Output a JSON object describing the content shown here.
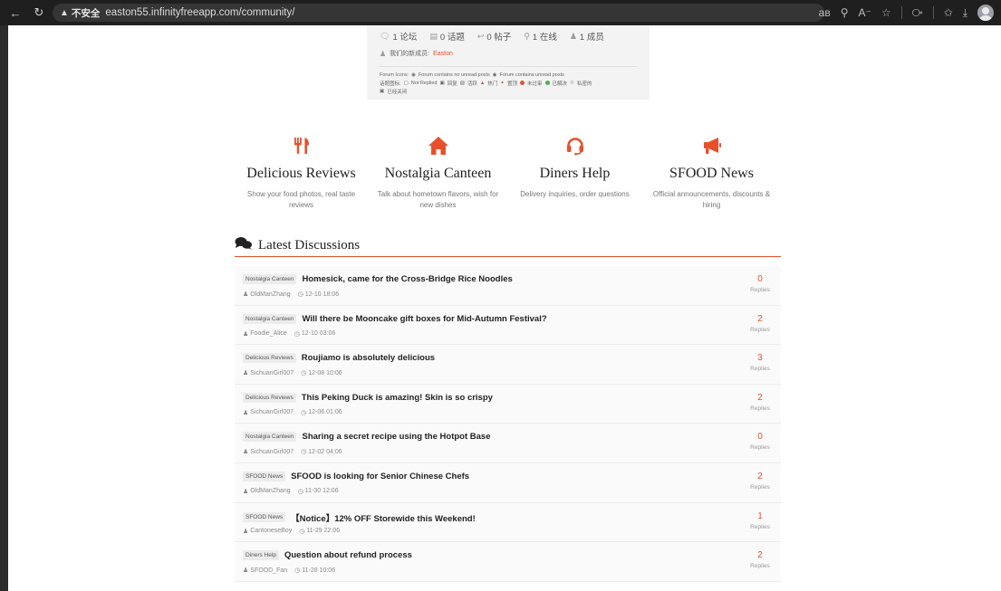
{
  "browser": {
    "security_label": "不安全",
    "url": "easton55.infinityfreeapp.com/community/"
  },
  "stats": {
    "forums": "1 论坛",
    "topics": "0 话题",
    "posts": "0 帖子",
    "online": "1 在线",
    "members": "1 成员",
    "newest_label": "我们的新成员:",
    "newest_name": "Easton",
    "forum_icons_label": "Forum Icons:",
    "forum_no_unread": "Forum contains no unread posts",
    "forum_unread": "Forum contains unread posts",
    "topic_icons_label": "话题图标:",
    "topic_icons": [
      "Not Replied",
      "回复",
      "活跃",
      "热门",
      "置顶",
      "未过审",
      "已解决",
      "私密的"
    ],
    "closed": "已经关闭"
  },
  "categories": [
    {
      "title": "Delicious Reviews",
      "desc": "Show your food photos, real taste reviews",
      "icon": "utensils-icon"
    },
    {
      "title": "Nostalgia Canteen",
      "desc": "Talk about hometown flavors, wish for new dishes",
      "icon": "home-icon"
    },
    {
      "title": "Diners Help",
      "desc": "Delivery inquiries, order questions",
      "icon": "headset-icon"
    },
    {
      "title": "SFOOD News",
      "desc": "Official announcements, discounts & hiring",
      "icon": "megaphone-icon"
    }
  ],
  "latest": {
    "title": "Latest Discussions",
    "replies_label": "Replies",
    "items": [
      {
        "tag": "Nostalgia Canteen",
        "title": "Homesick, came for the Cross-Bridge Rice Noodles",
        "user": "OldManZhang",
        "time": "12-10 18:06",
        "replies": "0"
      },
      {
        "tag": "Nostalgia Canteen",
        "title": "Will there be Mooncake gift boxes for Mid-Autumn Festival?",
        "user": "Foodie_Alice",
        "time": "12-10 03:06",
        "replies": "2"
      },
      {
        "tag": "Delicious Reviews",
        "title": "Roujiamo is absolutely delicious",
        "user": "SichuanGirl007",
        "time": "12-08 10:06",
        "replies": "3"
      },
      {
        "tag": "Delicious Reviews",
        "title": "This Peking Duck is amazing! Skin is so crispy",
        "user": "SichuanGirl007",
        "time": "12-06 01:06",
        "replies": "2"
      },
      {
        "tag": "Nostalgia Canteen",
        "title": "Sharing a secret recipe using the Hotpot Base",
        "user": "SichuanGirl007",
        "time": "12-02 04:06",
        "replies": "0"
      },
      {
        "tag": "SFOOD News",
        "title": "SFOOD is looking for Senior Chinese Chefs",
        "user": "OldManZhang",
        "time": "11-30 12:06",
        "replies": "2"
      },
      {
        "tag": "SFOOD News",
        "title": "【Notice】12% OFF Storewide this Weekend!",
        "user": "CantoneseBoy",
        "time": "11-29 22:06",
        "replies": "1"
      },
      {
        "tag": "Diners Help",
        "title": "Question about refund process",
        "user": "SFOOD_Fan",
        "time": "11-28 10:06",
        "replies": "2"
      }
    ]
  },
  "colors": {
    "accent": "#e8502d"
  }
}
